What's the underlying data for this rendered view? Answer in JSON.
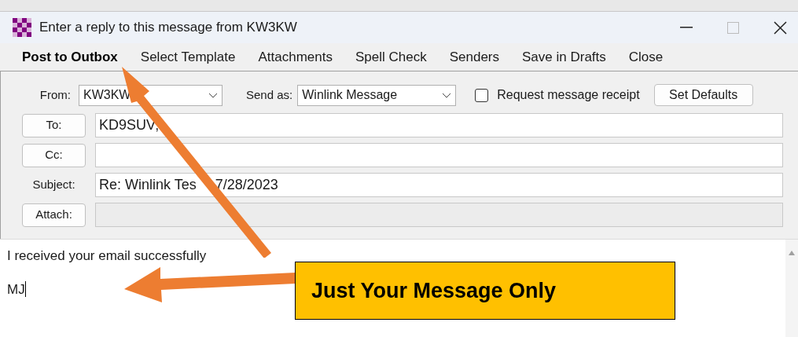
{
  "window": {
    "title": "Enter a reply to this message from KW3KW"
  },
  "menu": [
    {
      "label": "Post to Outbox",
      "emphasized": true
    },
    {
      "label": "Select Template",
      "emphasized": false
    },
    {
      "label": "Attachments",
      "emphasized": false
    },
    {
      "label": "Spell Check",
      "emphasized": false
    },
    {
      "label": "Senders",
      "emphasized": false
    },
    {
      "label": "Save in Drafts",
      "emphasized": false
    },
    {
      "label": "Close",
      "emphasized": false
    }
  ],
  "form": {
    "from": {
      "label": "From:",
      "value": "KW3KW"
    },
    "send_as": {
      "label": "Send as:",
      "value": "Winlink Message"
    },
    "receipt": {
      "label": "Request message receipt",
      "checked": false
    },
    "set_defaults": "Set Defaults",
    "fields": [
      {
        "kind": "button",
        "label": "To:",
        "value": "KD9SUV;",
        "disabled": false
      },
      {
        "kind": "button",
        "label": "Cc:",
        "disabled": false
      },
      {
        "kind": "label",
        "label": "Subject:",
        "value": [
          "Re: Winlink Tes",
          "7/28/2023"
        ],
        "disabled": false
      },
      {
        "kind": "button",
        "label": "Attach:",
        "disabled": true
      }
    ]
  },
  "body": {
    "lines": [
      "I received your email successfully",
      "MJ"
    ]
  },
  "callout": {
    "text": "Just Your Message Only"
  }
}
